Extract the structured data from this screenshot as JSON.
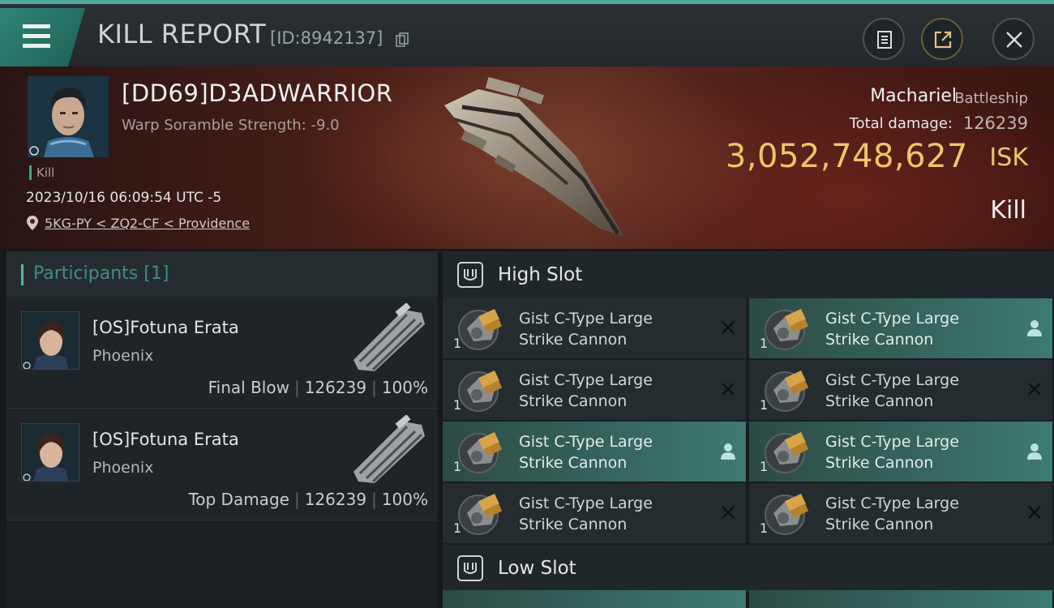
{
  "header": {
    "title": "KILL REPORT",
    "report_id": "[ID:8942137]"
  },
  "victim": {
    "name": "[DD69]D3ADWARRIOR",
    "warp_scramble": "Warp Soramble Strength: -9.0",
    "kill_tag": "Kill",
    "timestamp": "2023/10/16 06:09:54 UTC -5",
    "location": "5KG-PY < ZQ2-CF < Providence",
    "ship_name": "Machariel",
    "ship_class": "Battleship",
    "total_damage_label": "Total damage:",
    "total_damage": "126239",
    "isk_value": "3,052,748,627",
    "isk_unit": "ISK",
    "result": "Kill"
  },
  "participants": {
    "title": "Participants",
    "count": "[1]",
    "rows": [
      {
        "name": "[OS]Fotuna Erata",
        "ship": "Phoenix",
        "role": "Final Blow",
        "damage": "126239",
        "percent": "100%"
      },
      {
        "name": "[OS]Fotuna Erata",
        "ship": "Phoenix",
        "role": "Top Damage",
        "damage": "126239",
        "percent": "100%"
      }
    ],
    "separator": "|"
  },
  "fitting": {
    "high_slot": {
      "title": "High Slot",
      "modules": [
        {
          "line1": "Gist C-Type Large",
          "line2": "Strike Cannon",
          "qty": "1",
          "status": "destroyed",
          "active": false
        },
        {
          "line1": "Gist C-Type Large",
          "line2": "Strike Cannon",
          "qty": "1",
          "status": "dropped",
          "active": true
        },
        {
          "line1": "Gist C-Type Large",
          "line2": "Strike Cannon",
          "qty": "1",
          "status": "destroyed",
          "active": false
        },
        {
          "line1": "Gist C-Type Large",
          "line2": "Strike Cannon",
          "qty": "1",
          "status": "destroyed",
          "active": false
        },
        {
          "line1": "Gist C-Type Large",
          "line2": "Strike Cannon",
          "qty": "1",
          "status": "dropped",
          "active": true
        },
        {
          "line1": "Gist C-Type Large",
          "line2": "Strike Cannon",
          "qty": "1",
          "status": "dropped",
          "active": true
        },
        {
          "line1": "Gist C-Type Large",
          "line2": "Strike Cannon",
          "qty": "1",
          "status": "destroyed",
          "active": false
        },
        {
          "line1": "Gist C-Type Large",
          "line2": "Strike Cannon",
          "qty": "1",
          "status": "destroyed",
          "active": false
        }
      ]
    },
    "low_slot": {
      "title": "Low Slot"
    }
  },
  "icons": {
    "menu": "hamburger-icon",
    "copy": "copy-icon",
    "clipboard": "clipboard-icon",
    "share": "share-icon",
    "close": "close-icon",
    "location": "location-pin-icon",
    "slot": "slot-icon",
    "destroyed": "x-mark-icon",
    "dropped": "person-icon"
  },
  "colors": {
    "accent": "#4fa99a",
    "isk": "#efc56b",
    "active_module": "#3d7a70",
    "hero_red": "#5a2a20"
  }
}
